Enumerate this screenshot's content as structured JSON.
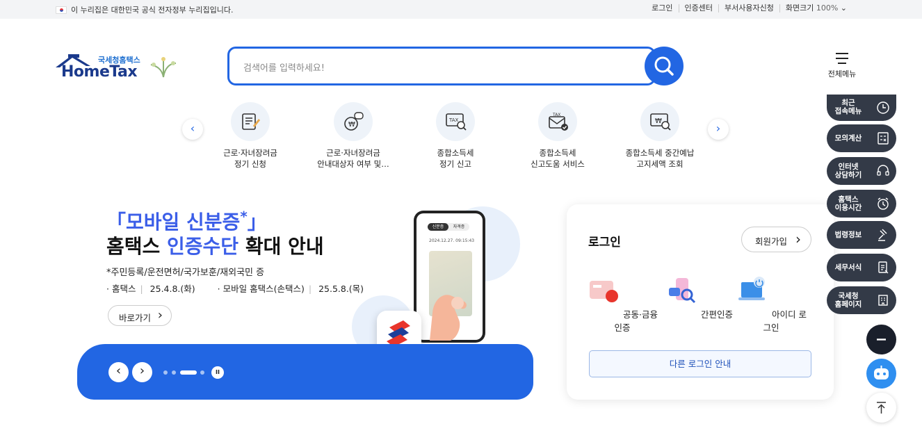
{
  "topbar": {
    "gov_notice": "이 누리집은 대한민국 공식 전자정부 누리집입니다.",
    "links": [
      "로그인",
      "인증센터",
      "부서사용자신청"
    ],
    "zoom_label": "화면크기",
    "zoom_value": "100%"
  },
  "logo": {
    "sub": "국세청홈택스",
    "main": "HomeTax"
  },
  "search": {
    "placeholder": "검색어를 입력하세요!"
  },
  "menu": {
    "label": "전체메뉴"
  },
  "quick": [
    {
      "line1": "근로·자녀장려금",
      "line2": "정기 신청"
    },
    {
      "line1": "근로·자녀장려금",
      "line2": "안내대상자 여부 및…"
    },
    {
      "line1": "종합소득세",
      "line2": "정기 신고"
    },
    {
      "line1": "종합소득세",
      "line2": "신고도움 서비스"
    },
    {
      "line1": "종합소득세 중간예납",
      "line2": "고지세액 조회"
    }
  ],
  "banner": {
    "title1": "「모바일 신분증",
    "title1_mark": "*",
    "title1_end": "」",
    "title2_a": "홈택스 ",
    "title2_b": "인증수단",
    "title2_c": " 확대 안내",
    "note": "*주민등록/운전면허/국가보훈/재외국민 증",
    "item1": "· 홈택스",
    "date1": "25.4.8.(화)",
    "item2": "· 모바일 홈택스(손택스)",
    "date2": "25.5.8.(목)",
    "go": "바로가기"
  },
  "phone": {
    "tab1": "신분증",
    "tab2": "자격증",
    "stamp": "2024.12.27. 09:15:43"
  },
  "login": {
    "title": "로그인",
    "join": "회원가입",
    "opt1": "공동·금융인증",
    "opt2": "간편인증",
    "opt3": "아이디 로그인",
    "other": "다른 로그인 안내"
  },
  "side": [
    {
      "l1": "최근",
      "l2": "접속메뉴"
    },
    {
      "l1": "모의계산",
      "l2": ""
    },
    {
      "l1": "인터넷",
      "l2": "상담하기"
    },
    {
      "l1": "홈택스",
      "l2": "이용시간"
    },
    {
      "l1": "법령정보",
      "l2": ""
    },
    {
      "l1": "세무서식",
      "l2": ""
    },
    {
      "l1": "국세청",
      "l2": "홈페이지"
    }
  ],
  "colors": {
    "primary": "#2266e3",
    "dark": "#333a47"
  }
}
